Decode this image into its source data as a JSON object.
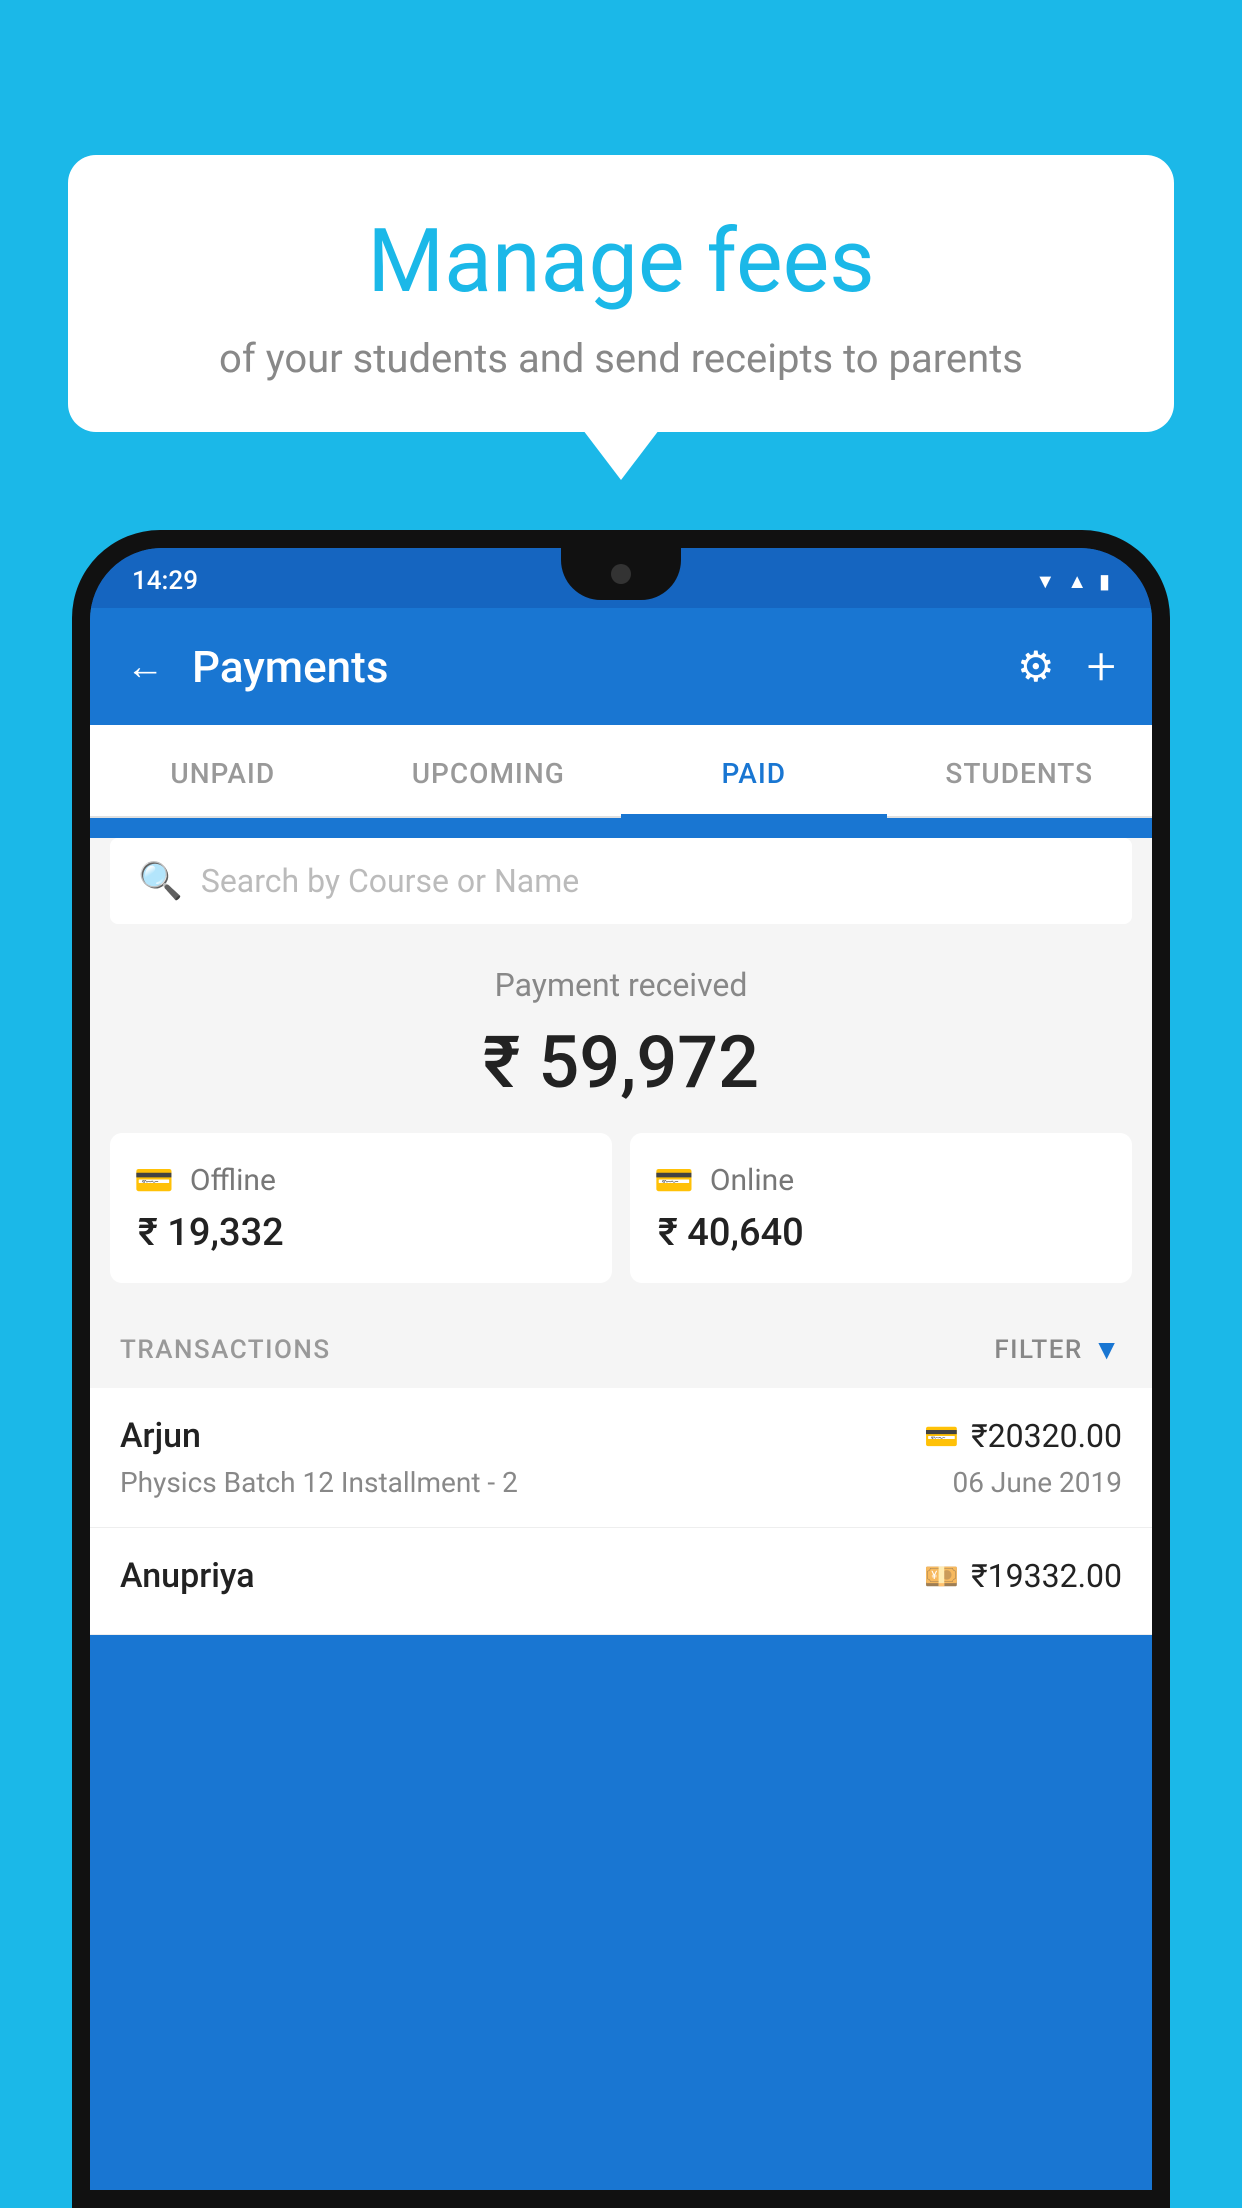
{
  "background_color": "#1bb8e8",
  "speech_bubble": {
    "title": "Manage fees",
    "subtitle": "of your students and send receipts to parents"
  },
  "status_bar": {
    "time": "14:29",
    "icons": [
      "wifi",
      "signal",
      "battery"
    ]
  },
  "app_header": {
    "title": "Payments",
    "back_label": "←",
    "settings_label": "⚙",
    "add_label": "+"
  },
  "tabs": [
    {
      "label": "UNPAID",
      "active": false
    },
    {
      "label": "UPCOMING",
      "active": false
    },
    {
      "label": "PAID",
      "active": true
    },
    {
      "label": "STUDENTS",
      "active": false
    }
  ],
  "search": {
    "placeholder": "Search by Course or Name"
  },
  "payment_summary": {
    "label": "Payment received",
    "amount": "₹ 59,972",
    "offline": {
      "type": "Offline",
      "amount": "₹ 19,332"
    },
    "online": {
      "type": "Online",
      "amount": "₹ 40,640"
    }
  },
  "transactions": {
    "label": "TRANSACTIONS",
    "filter_label": "FILTER",
    "rows": [
      {
        "name": "Arjun",
        "course": "Physics Batch 12 Installment - 2",
        "amount": "₹20320.00",
        "date": "06 June 2019",
        "payment_type": "card"
      },
      {
        "name": "Anupriya",
        "course": "",
        "amount": "₹19332.00",
        "date": "",
        "payment_type": "cash"
      }
    ]
  }
}
